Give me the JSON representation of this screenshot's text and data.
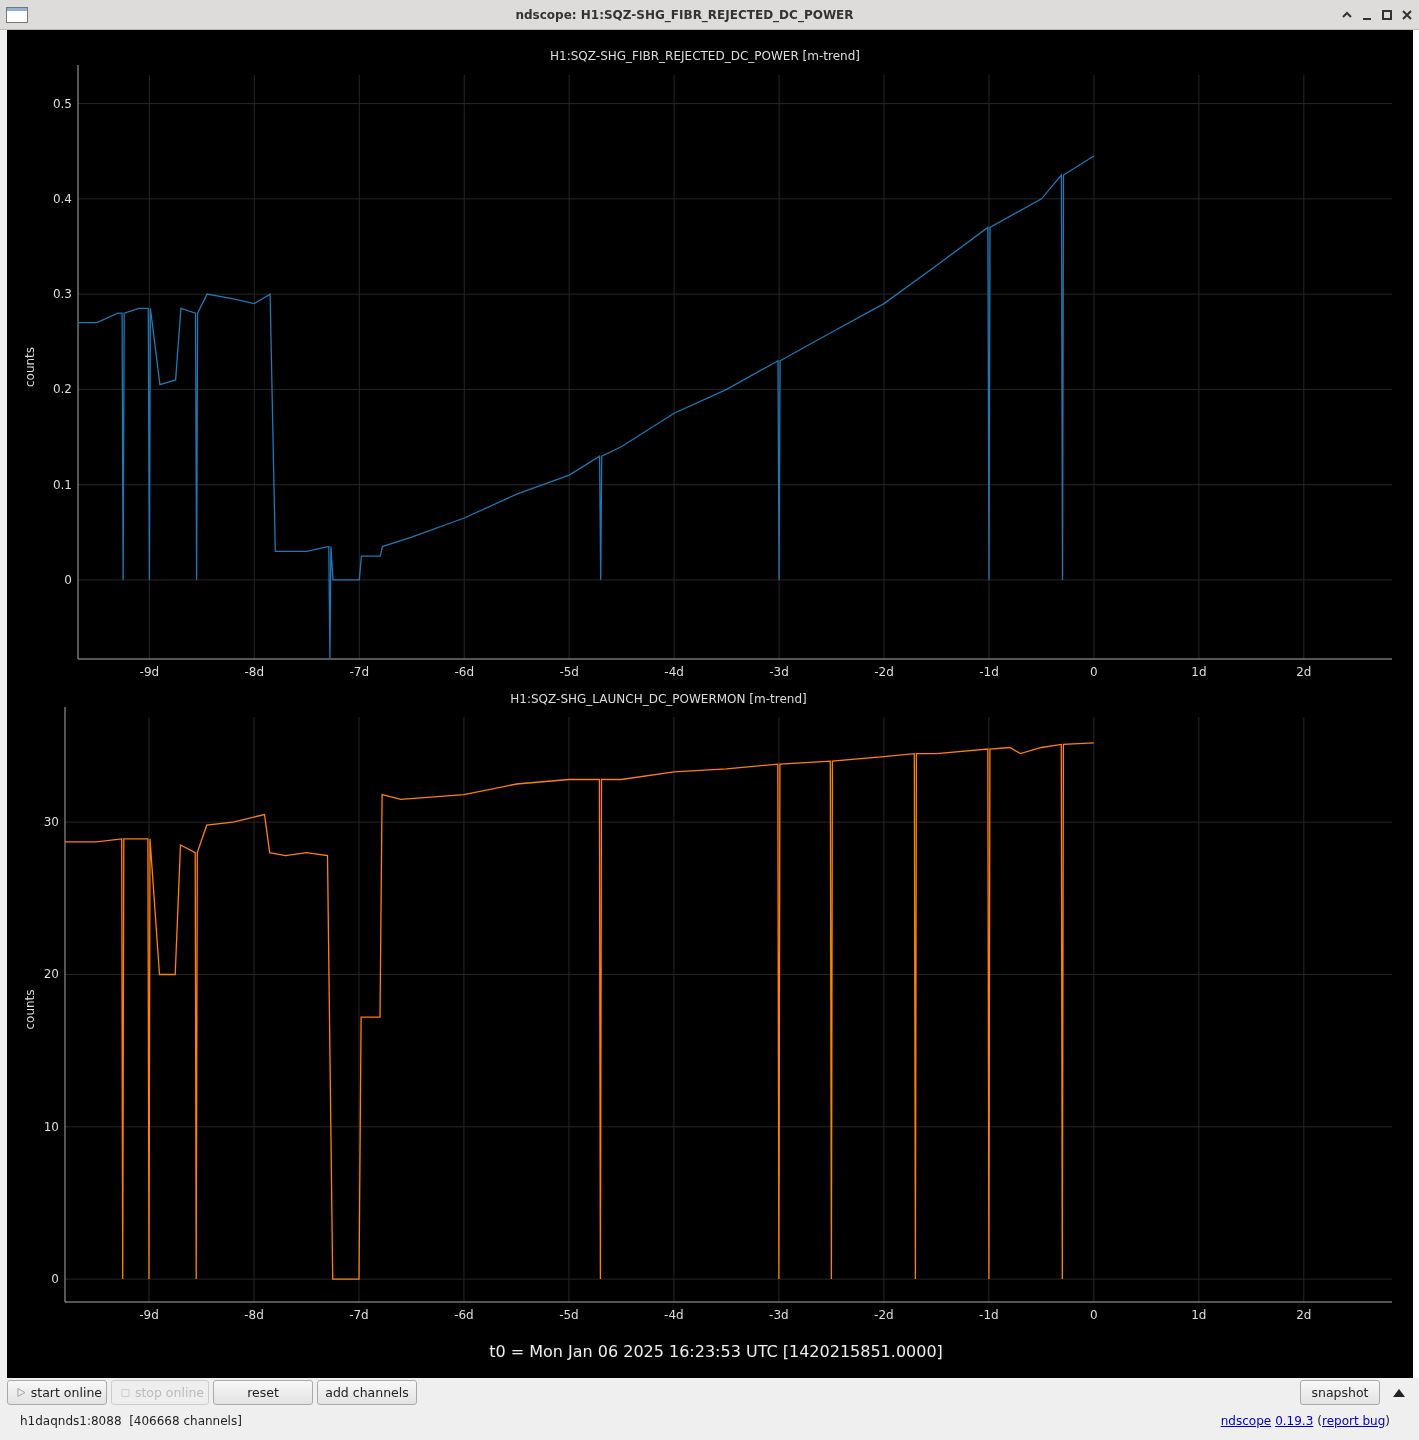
{
  "window": {
    "title": "ndscope: H1:SQZ-SHG_FIBR_REJECTED_DC_POWER"
  },
  "plots": [
    {
      "chart_data": {
        "type": "line",
        "title": "H1:SQZ-SHG_FIBR_REJECTED_DC_POWER [m-trend]",
        "ylabel": "counts",
        "x": [
          -9.68,
          -9.5,
          -9.3,
          -9.26,
          -9.25,
          -9.24,
          -9.1,
          -9.01,
          -9.0,
          -8.99,
          -8.9,
          -8.75,
          -8.7,
          -8.56,
          -8.55,
          -8.54,
          -8.45,
          -8.2,
          -8.0,
          -7.85,
          -7.8,
          -7.5,
          -7.3,
          -7.29,
          -7.28,
          -7.27,
          -7.25,
          -7.0,
          -6.98,
          -6.8,
          -6.78,
          -6.5,
          -6.0,
          -5.5,
          -5.0,
          -4.71,
          -4.7,
          -4.69,
          -4.5,
          -4.0,
          -3.5,
          -3.01,
          -3.0,
          -2.99,
          -2.5,
          -2.0,
          -1.5,
          -1.01,
          -1.0,
          -0.99,
          -0.5,
          -0.31,
          -0.3,
          -0.29,
          0.0
        ],
        "grid": true,
        "series": [
          {
            "color": "#1f77b4",
            "values": [
              0.27,
              0.27,
              0.28,
              0.28,
              0,
              0.28,
              0.285,
              0.285,
              0,
              0.285,
              0.205,
              0.21,
              0.285,
              0.28,
              0,
              0.28,
              0.3,
              0.295,
              0.29,
              0.3,
              0.03,
              0.03,
              0.035,
              0.035,
              -0.083,
              0.035,
              0,
              0,
              0.025,
              0.025,
              0.035,
              0.045,
              0.065,
              0.09,
              0.11,
              0.13,
              0,
              0.13,
              0.14,
              0.175,
              0.2,
              0.23,
              0,
              0.23,
              0.26,
              0.29,
              0.33,
              0.37,
              0,
              0.37,
              0.4,
              0.425,
              0,
              0.425,
              0.445
            ]
          }
        ],
        "xlim": [
          -9.68,
          2.84
        ],
        "ylim": [
          -0.083,
          0.53
        ],
        "xticks": [
          {
            "value": -9,
            "label": "-9d"
          },
          {
            "value": -8,
            "label": "-8d"
          },
          {
            "value": -7,
            "label": "-7d"
          },
          {
            "value": -6,
            "label": "-6d"
          },
          {
            "value": -5,
            "label": "-5d"
          },
          {
            "value": -4,
            "label": "-4d"
          },
          {
            "value": -3,
            "label": "-3d"
          },
          {
            "value": -2,
            "label": "-2d"
          },
          {
            "value": -1,
            "label": "-1d"
          },
          {
            "value": 0,
            "label": "0"
          },
          {
            "value": 1,
            "label": "1d"
          },
          {
            "value": 2,
            "label": "2d"
          }
        ],
        "yticks": [
          0,
          0.1,
          0.2,
          0.3,
          0.4,
          0.5
        ]
      }
    },
    {
      "chart_data": {
        "type": "line",
        "title": "H1:SQZ-SHG_LAUNCH_DC_POWERMON [m-trend]",
        "ylabel": "counts",
        "x": [
          -9.8,
          -9.5,
          -9.26,
          -9.25,
          -9.24,
          -9.01,
          -9.0,
          -8.99,
          -8.9,
          -8.75,
          -8.7,
          -8.56,
          -8.55,
          -8.54,
          -8.45,
          -8.2,
          -7.9,
          -7.85,
          -7.7,
          -7.5,
          -7.3,
          -7.25,
          -7.0,
          -6.98,
          -6.8,
          -6.78,
          -6.6,
          -6.0,
          -5.5,
          -5.0,
          -4.71,
          -4.7,
          -4.69,
          -4.5,
          -4.0,
          -3.5,
          -3.01,
          -3.0,
          -2.99,
          -2.51,
          -2.5,
          -2.49,
          -2.0,
          -1.71,
          -1.7,
          -1.69,
          -1.5,
          -1.01,
          -1.0,
          -0.99,
          -0.8,
          -0.7,
          -0.5,
          -0.31,
          -0.3,
          -0.29,
          0.0
        ],
        "grid": true,
        "series": [
          {
            "color": "#ff7f0e",
            "values": [
              28.7,
              28.7,
              28.9,
              0,
              28.9,
              28.9,
              0,
              28.9,
              20,
              20,
              28.5,
              28,
              0,
              28,
              29.8,
              30,
              30.5,
              28,
              27.8,
              28,
              27.8,
              0,
              0,
              17.2,
              17.2,
              31.8,
              31.5,
              31.8,
              32.5,
              32.8,
              32.8,
              0,
              32.8,
              32.8,
              33.3,
              33.5,
              33.8,
              0,
              33.8,
              34,
              0,
              34,
              34.3,
              34.5,
              0,
              34.5,
              34.5,
              34.8,
              0,
              34.8,
              34.9,
              34.5,
              34.9,
              35.1,
              0,
              35.1,
              35.2
            ]
          }
        ],
        "xlim": [
          -9.8,
          2.84
        ],
        "ylim": [
          -1.5,
          36.9
        ],
        "xticks": [
          {
            "value": -9,
            "label": "-9d"
          },
          {
            "value": -8,
            "label": "-8d"
          },
          {
            "value": -7,
            "label": "-7d"
          },
          {
            "value": -6,
            "label": "-6d"
          },
          {
            "value": -5,
            "label": "-5d"
          },
          {
            "value": -4,
            "label": "-4d"
          },
          {
            "value": -3,
            "label": "-3d"
          },
          {
            "value": -2,
            "label": "-2d"
          },
          {
            "value": -1,
            "label": "-1d"
          },
          {
            "value": 0,
            "label": "0"
          },
          {
            "value": 1,
            "label": "1d"
          },
          {
            "value": 2,
            "label": "2d"
          }
        ],
        "yticks": [
          0,
          10,
          20,
          30
        ]
      }
    }
  ],
  "t0_label": "t0 = Mon Jan 06 2025 16:23:53 UTC [1420215851.0000]",
  "toolbar": {
    "buttons": [
      {
        "kind": "play",
        "label": "start online",
        "disabled": false
      },
      {
        "kind": "stop",
        "label": "stop online",
        "disabled": true
      },
      {
        "kind": "plain",
        "label": "reset",
        "disabled": false
      },
      {
        "kind": "plain",
        "label": "add channels",
        "disabled": false
      }
    ],
    "snapshot": "snapshot"
  },
  "status": {
    "server": "h1daqnds1:8088  [406668 channels]",
    "app_link": "ndscope",
    "version_link": "0.19.3",
    "open_paren": "(",
    "bug_link": "report bug",
    "close_paren": ")"
  }
}
